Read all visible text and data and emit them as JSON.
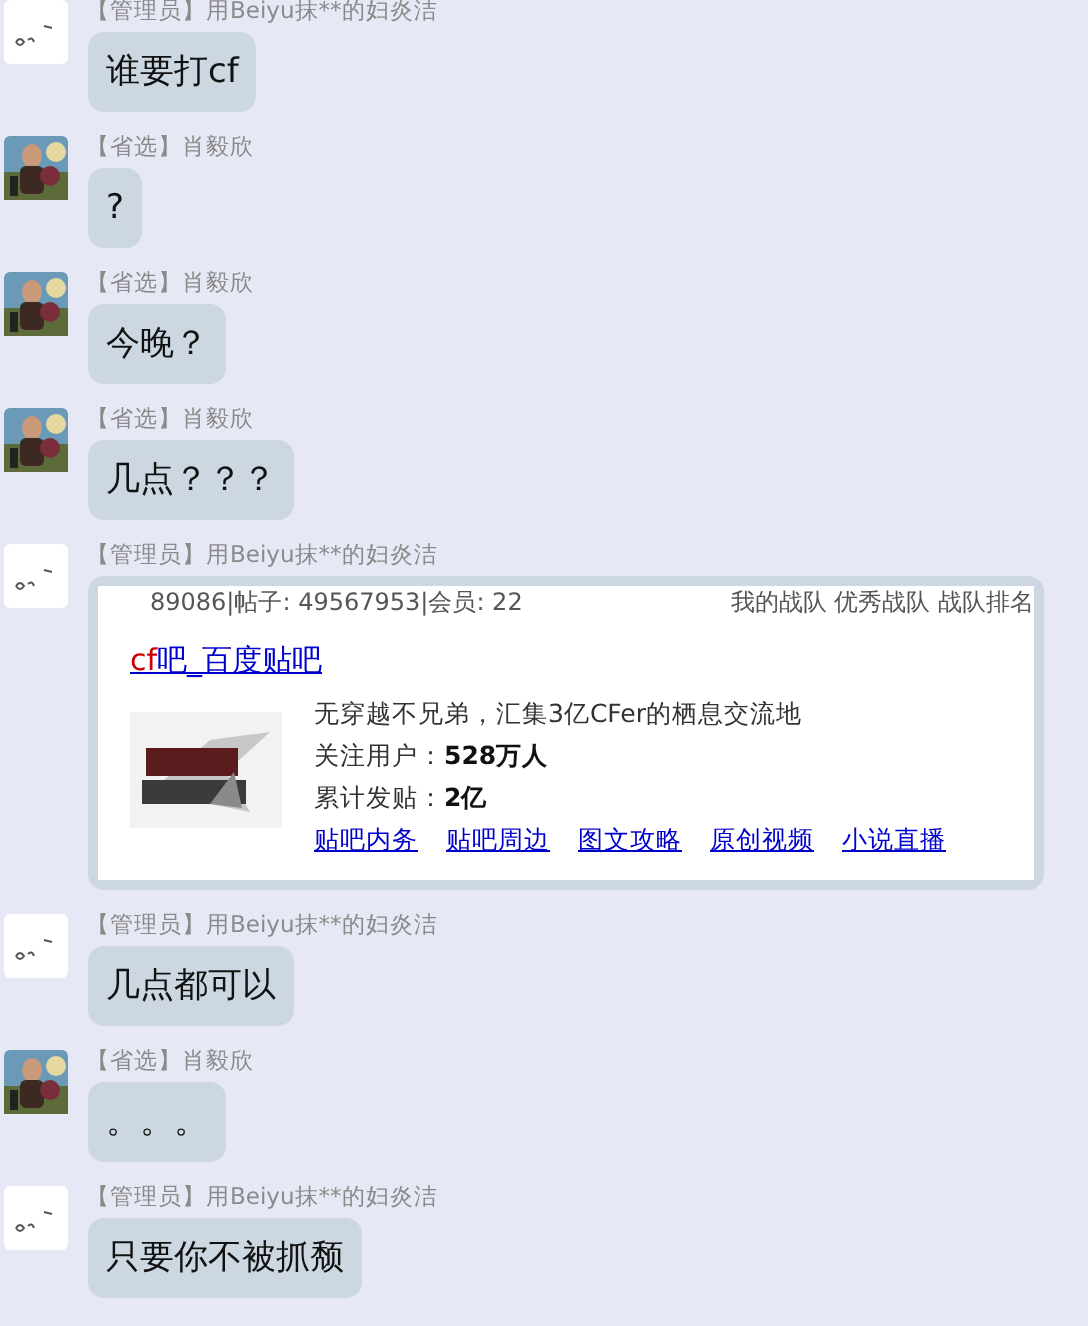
{
  "messages": [
    {
      "kind": "text",
      "avatar": {
        "kind": "doodle"
      },
      "sender": "【管理员】用Beiyu抹**的妇炎洁",
      "text": "谁要打cf"
    },
    {
      "kind": "text",
      "sender": "【省选】肖毅欣",
      "text": "?"
    },
    {
      "kind": "text",
      "sender": "【省选】肖毅欣",
      "text": "今晚？"
    },
    {
      "kind": "text",
      "sender": "【省选】肖毅欣",
      "text": "几点？？？"
    },
    {
      "kind": "card",
      "avatar": {
        "kind": "doodle"
      },
      "sender": "【管理员】用Beiyu抹**的妇炎洁",
      "card": {
        "stats_line": "89086|帖子: 49567953|会员: 22",
        "nav_line": "我的战队 优秀战队 战队排名",
        "title_highlight": "cf",
        "title_rest": "吧_百度贴吧",
        "description": "无穿越不兄弟，汇集3亿CFer的栖息交流地",
        "stats": [
          {
            "label": "关注用户：",
            "value": "528万人"
          },
          {
            "label": "累计发贴：",
            "value": "2亿"
          }
        ],
        "links": [
          "贴吧内务",
          "贴吧周边",
          "图文攻略",
          "原创视频",
          "小说直播"
        ]
      }
    },
    {
      "kind": "text",
      "avatar": {
        "kind": "doodle"
      },
      "sender": "【管理员】用Beiyu抹**的妇炎洁",
      "text": "几点都可以"
    },
    {
      "kind": "text",
      "sender": "【省选】肖毅欣",
      "text": "。。。"
    },
    {
      "kind": "text",
      "avatar": {
        "kind": "doodle"
      },
      "sender": "【管理员】用Beiyu抹**的妇炎洁",
      "text": "只要你不被抓颓"
    }
  ]
}
